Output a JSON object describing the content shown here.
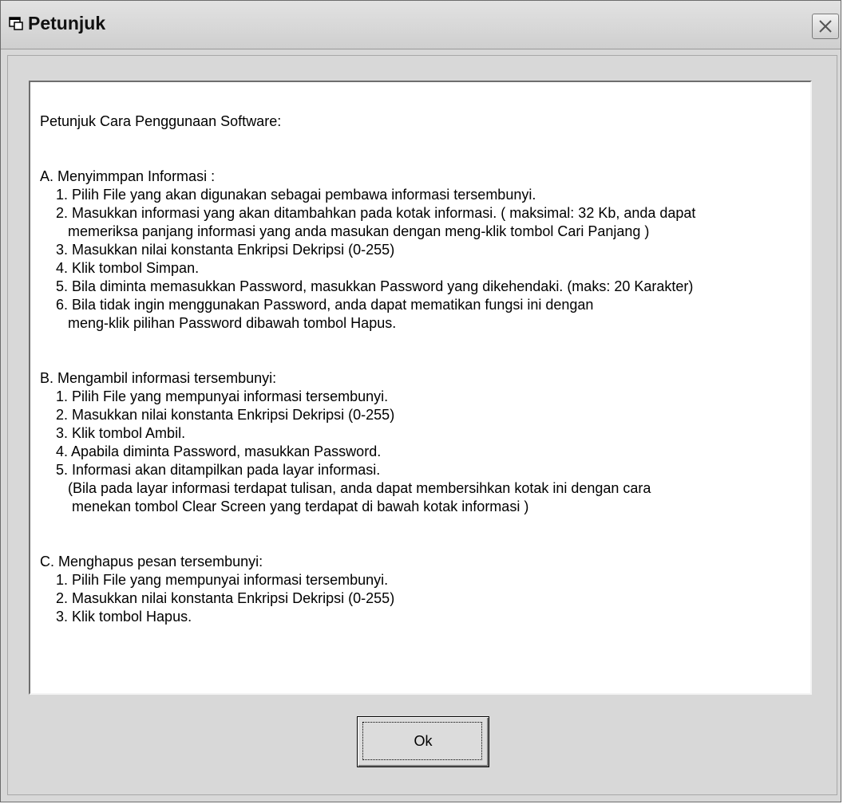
{
  "window": {
    "title": "Petunjuk",
    "close_icon": "close-icon",
    "app_icon": "window-icon"
  },
  "content": {
    "text": "Petunjuk Cara Penggunaan Software:\n\n\nA. Menyimmpan Informasi :\n    1. Pilih File yang akan digunakan sebagai pembawa informasi tersembunyi.\n    2. Masukkan informasi yang akan ditambahkan pada kotak informasi. ( maksimal: 32 Kb, anda dapat\n       memeriksa panjang informasi yang anda masukan dengan meng-klik tombol Cari Panjang )\n    3. Masukkan nilai konstanta Enkripsi Dekripsi (0-255)\n    4. Klik tombol Simpan.\n    5. Bila diminta memasukkan Password, masukkan Password yang dikehendaki. (maks: 20 Karakter)\n    6. Bila tidak ingin menggunakan Password, anda dapat mematikan fungsi ini dengan\n       meng-klik pilihan Password dibawah tombol Hapus.\n\n\nB. Mengambil informasi tersembunyi:\n    1. Pilih File yang mempunyai informasi tersembunyi.\n    2. Masukkan nilai konstanta Enkripsi Dekripsi (0-255)\n    3. Klik tombol Ambil.\n    4. Apabila diminta Password, masukkan Password.\n    5. Informasi akan ditampilkan pada layar informasi.\n       (Bila pada layar informasi terdapat tulisan, anda dapat membersihkan kotak ini dengan cara\n        menekan tombol Clear Screen yang terdapat di bawah kotak informasi )\n\n\nC. Menghapus pesan tersembunyi:\n    1. Pilih File yang mempunyai informasi tersembunyi.\n    2. Masukkan nilai konstanta Enkripsi Dekripsi (0-255)\n    3. Klik tombol Hapus."
  },
  "buttons": {
    "ok_label": "Ok"
  }
}
